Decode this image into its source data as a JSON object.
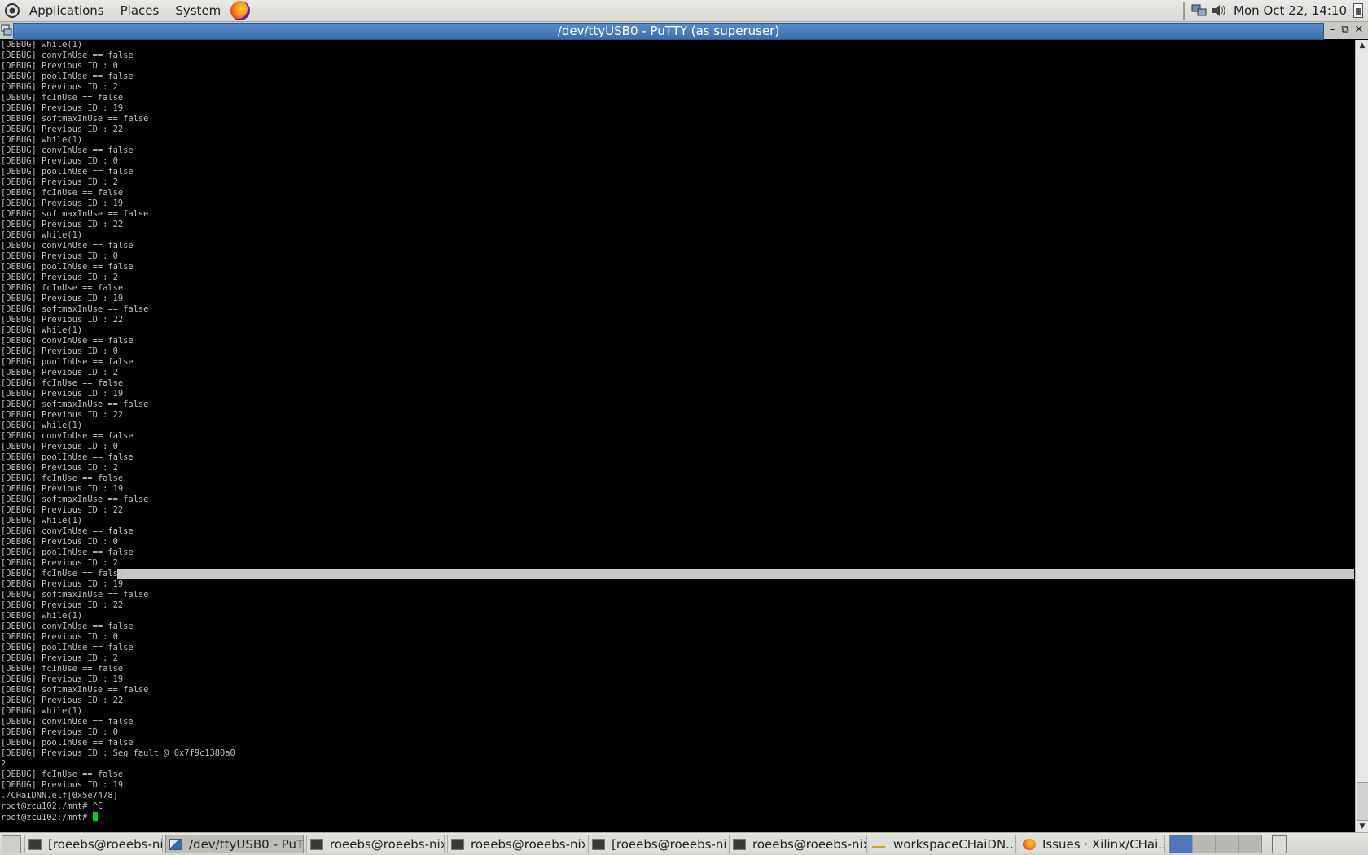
{
  "top_panel": {
    "menus": [
      "Applications",
      "Places",
      "System"
    ],
    "clock": "Mon Oct 22, 14:10"
  },
  "window": {
    "title": "/dev/ttyUSB0 - PuTTY (as superuser)"
  },
  "terminal": {
    "lines": [
      "[DEBUG] while(1)",
      "[DEBUG] convInUse == false",
      "[DEBUG] Previous ID : 0",
      "[DEBUG] poolInUse == false",
      "[DEBUG] Previous ID : 2",
      "[DEBUG] fcInUse == false",
      "[DEBUG] Previous ID : 19",
      "[DEBUG] softmaxInUse == false",
      "[DEBUG] Previous ID : 22",
      "[DEBUG] while(1)",
      "[DEBUG] convInUse == false",
      "[DEBUG] Previous ID : 0",
      "[DEBUG] poolInUse == false",
      "[DEBUG] Previous ID : 2",
      "[DEBUG] fcInUse == false",
      "[DEBUG] Previous ID : 19",
      "[DEBUG] softmaxInUse == false",
      "[DEBUG] Previous ID : 22",
      "[DEBUG] while(1)",
      "[DEBUG] convInUse == false",
      "[DEBUG] Previous ID : 0",
      "[DEBUG] poolInUse == false",
      "[DEBUG] Previous ID : 2",
      "[DEBUG] fcInUse == false",
      "[DEBUG] Previous ID : 19",
      "[DEBUG] softmaxInUse == false",
      "[DEBUG] Previous ID : 22",
      "[DEBUG] while(1)",
      "[DEBUG] convInUse == false",
      "[DEBUG] Previous ID : 0",
      "[DEBUG] poolInUse == false",
      "[DEBUG] Previous ID : 2",
      "[DEBUG] fcInUse == false",
      "[DEBUG] Previous ID : 19",
      "[DEBUG] softmaxInUse == false",
      "[DEBUG] Previous ID : 22",
      "[DEBUG] while(1)",
      "[DEBUG] convInUse == false",
      "[DEBUG] Previous ID : 0",
      "[DEBUG] poolInUse == false",
      "[DEBUG] Previous ID : 2",
      "[DEBUG] fcInUse == false",
      "[DEBUG] Previous ID : 19",
      "[DEBUG] softmaxInUse == false",
      "[DEBUG] Previous ID : 22",
      "[DEBUG] while(1)",
      "[DEBUG] convInUse == false",
      "[DEBUG] Previous ID : 0",
      "[DEBUG] poolInUse == false",
      "[DEBUG] Previous ID : 2",
      "[DEBUG] fcInUse == false",
      "[DEBUG] Previous ID : 19",
      "[DEBUG] softmaxInUse == false",
      "[DEBUG] Previous ID : 22",
      "[DEBUG] while(1)",
      "[DEBUG] convInUse == false",
      "[DEBUG] Previous ID : 0",
      "[DEBUG] poolInUse == false",
      "[DEBUG] Previous ID : 2",
      "[DEBUG] fcInUse == false",
      "[DEBUG] Previous ID : 19",
      "[DEBUG] softmaxInUse == false",
      "[DEBUG] Previous ID : 22",
      "[DEBUG] while(1)",
      "[DEBUG] convInUse == false",
      "[DEBUG] Previous ID : 0",
      "[DEBUG] poolInUse == false",
      "[DEBUG] Previous ID : Seg fault @ 0x7f9c1380a0",
      "2",
      "[DEBUG] fcInUse == false",
      "[DEBUG] Previous ID : 19",
      "./CHaiDNN.elf[0x5e7478]",
      "root@zcu102:/mnt# ^C",
      "root@zcu102:/mnt# "
    ],
    "highlighted_line": 50
  },
  "taskbar": {
    "tasks": [
      {
        "label": "[roeebs@roeebs-ni...",
        "icon": "terminal-icon",
        "active": false
      },
      {
        "label": "/dev/ttyUSB0 - PuT...",
        "icon": "putty-icon",
        "active": true
      },
      {
        "label": "roeebs@roeebs-nix...",
        "icon": "terminal-icon",
        "active": false
      },
      {
        "label": "roeebs@roeebs-nix...",
        "icon": "terminal-icon",
        "active": false
      },
      {
        "label": "[roeebs@roeebs-ni...",
        "icon": "terminal-icon",
        "active": false
      },
      {
        "label": "roeebs@roeebs-nix...",
        "icon": "terminal-icon",
        "active": false
      },
      {
        "label": "workspaceCHaiDN...",
        "icon": "eclipse-icon",
        "active": false
      },
      {
        "label": "Issues · Xilinx/CHai...",
        "icon": "firefox-icon",
        "active": false
      }
    ]
  },
  "colors": {
    "terminal_bg": "#000000",
    "terminal_fg": "#c0c0c0",
    "cursor": "#00d000",
    "titlebar_active": "#4a7cbd",
    "selection_highlight": "#c7c7c7"
  }
}
